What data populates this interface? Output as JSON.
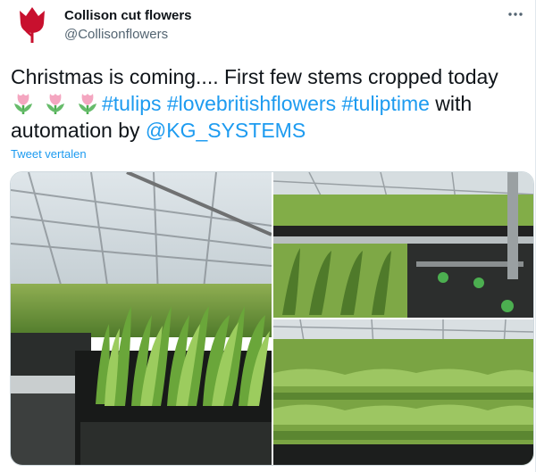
{
  "author": {
    "display_name": "Collison cut flowers",
    "handle": "@Collisonflowers",
    "avatar_icon": "tulip-icon",
    "avatar_color": "#c8102e"
  },
  "menu": {
    "more_icon": "more-dots-icon"
  },
  "tweet": {
    "text_part1": "Christmas is coming.... First few stems cropped today",
    "emoji": [
      "tulip-emoji",
      "tulip-emoji",
      "tulip-emoji"
    ],
    "hashtags": [
      "#tulips",
      "#lovebritishflowers",
      "#tuliptime"
    ],
    "text_with": " with",
    "text_automation": "automation by ",
    "mention": "@KG_SYSTEMS",
    "translate_label": "Tweet vertalen",
    "link_color": "#1d9bf0"
  },
  "media": {
    "photos": [
      {
        "name": "greenhouse-photo-1"
      },
      {
        "name": "greenhouse-photo-2"
      },
      {
        "name": "greenhouse-photo-3"
      }
    ]
  }
}
